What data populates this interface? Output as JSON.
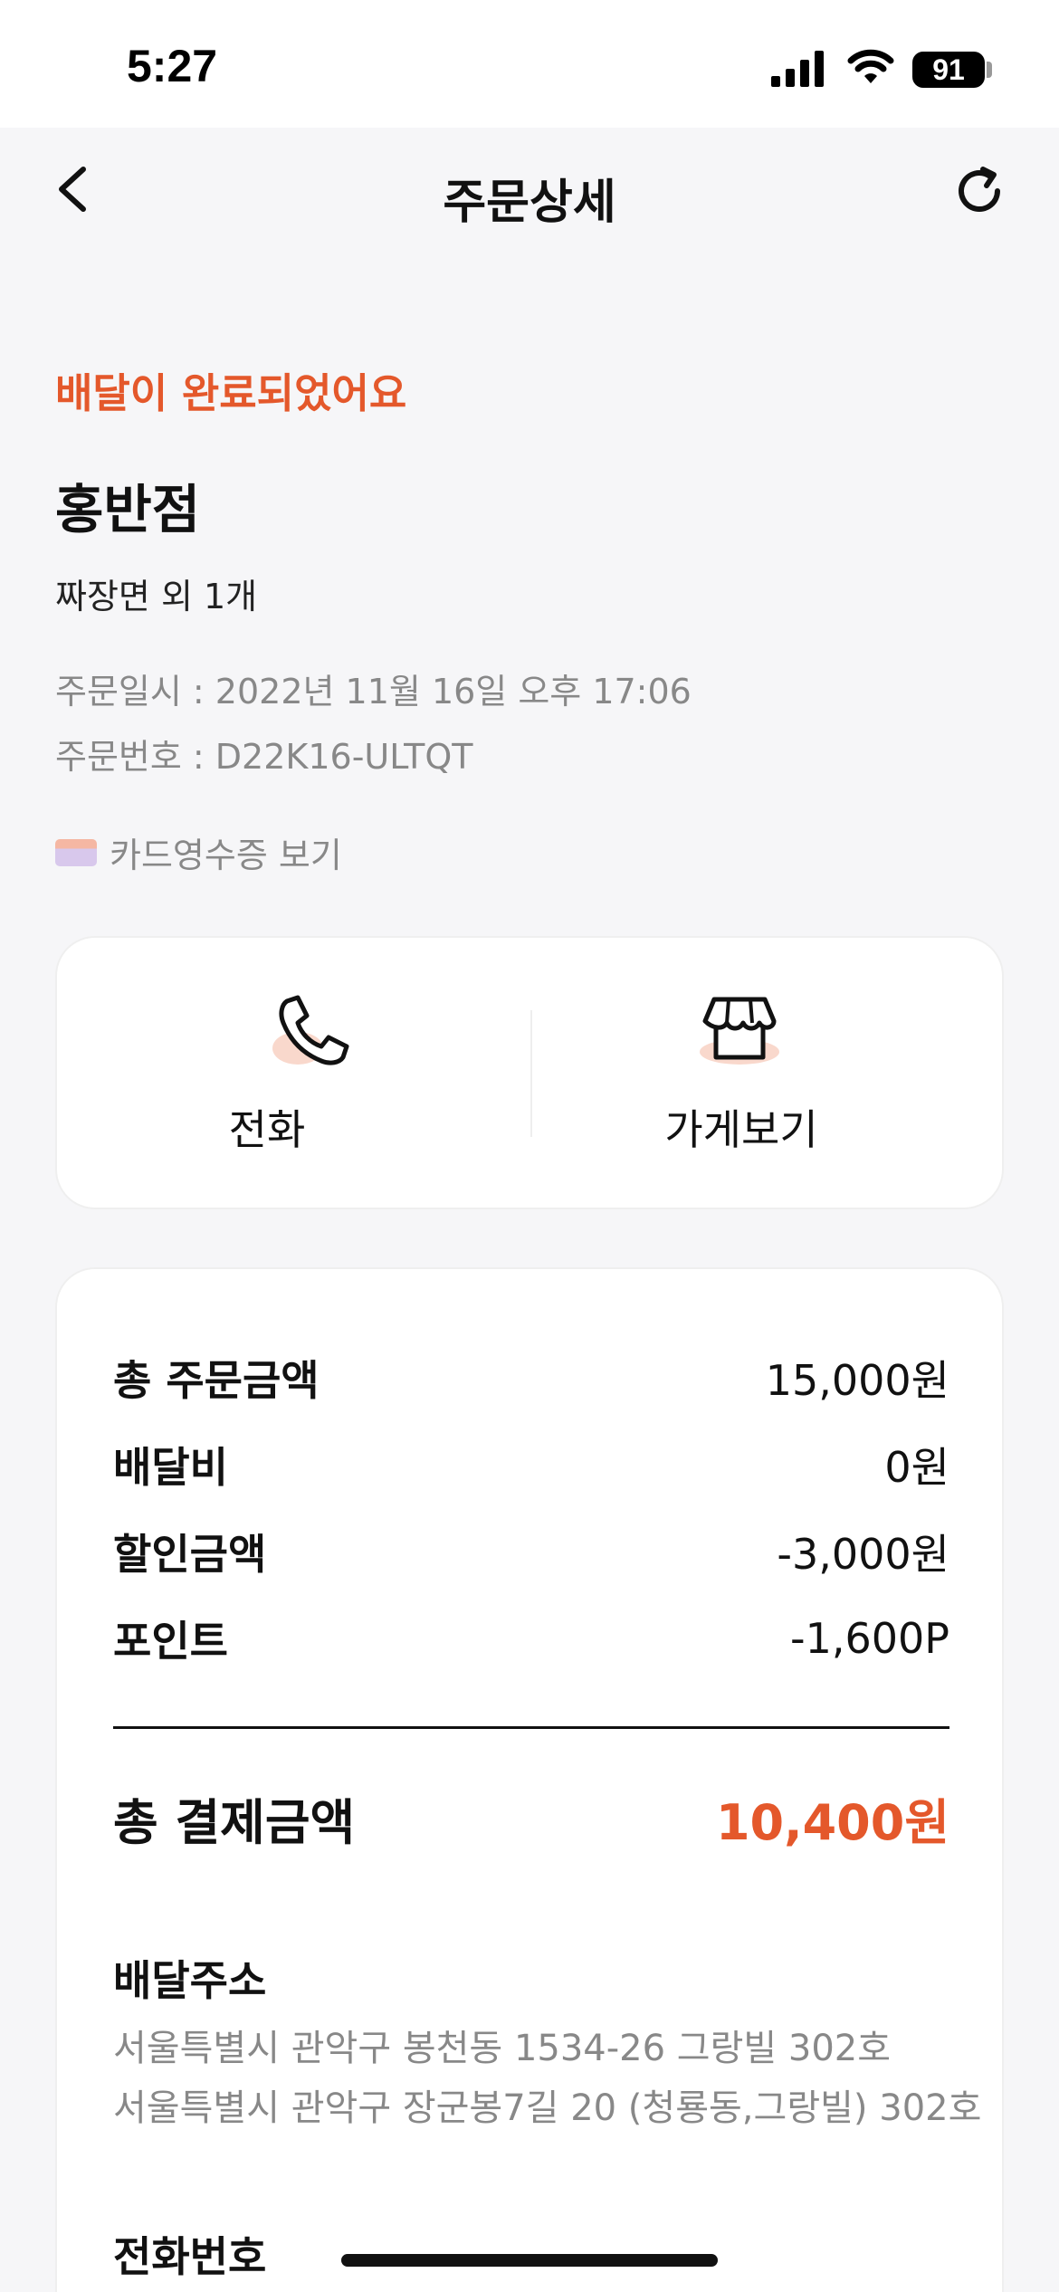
{
  "status_bar": {
    "time": "5:27",
    "battery": "91"
  },
  "nav": {
    "title": "주문상세"
  },
  "order": {
    "status": "배달이 완료되었어요",
    "store_name": "홍반점",
    "menu_summary": "짜장면 외 1개",
    "order_date": "주문일시 : 2022년 11월 16일 오후 17:06",
    "order_number": "주문번호 : D22K16-ULTQT",
    "receipt_link": "카드영수증 보기"
  },
  "actions": {
    "call_label": "전화",
    "store_label": "가게보기"
  },
  "payment": {
    "rows": [
      {
        "label": "총 주문금액",
        "value": "15,000원"
      },
      {
        "label": "배달비",
        "value": "0원"
      },
      {
        "label": "할인금액",
        "value": "-3,000원"
      },
      {
        "label": "포인트",
        "value": "-1,600P"
      }
    ],
    "total_label": "총 결제금액",
    "total_value": "10,400원"
  },
  "delivery": {
    "address_title": "배달주소",
    "address_line1": "서울특별시 관악구 봉천동 1534-26 그랑빌 302호",
    "address_line2": "서울특별시 관악구 장군봉7길 20 (청룡동,그랑빌) 302호",
    "phone_title": "전화번호"
  },
  "colors": {
    "accent": "#e4582b",
    "background": "#f6f6f8",
    "card": "#ffffff"
  }
}
